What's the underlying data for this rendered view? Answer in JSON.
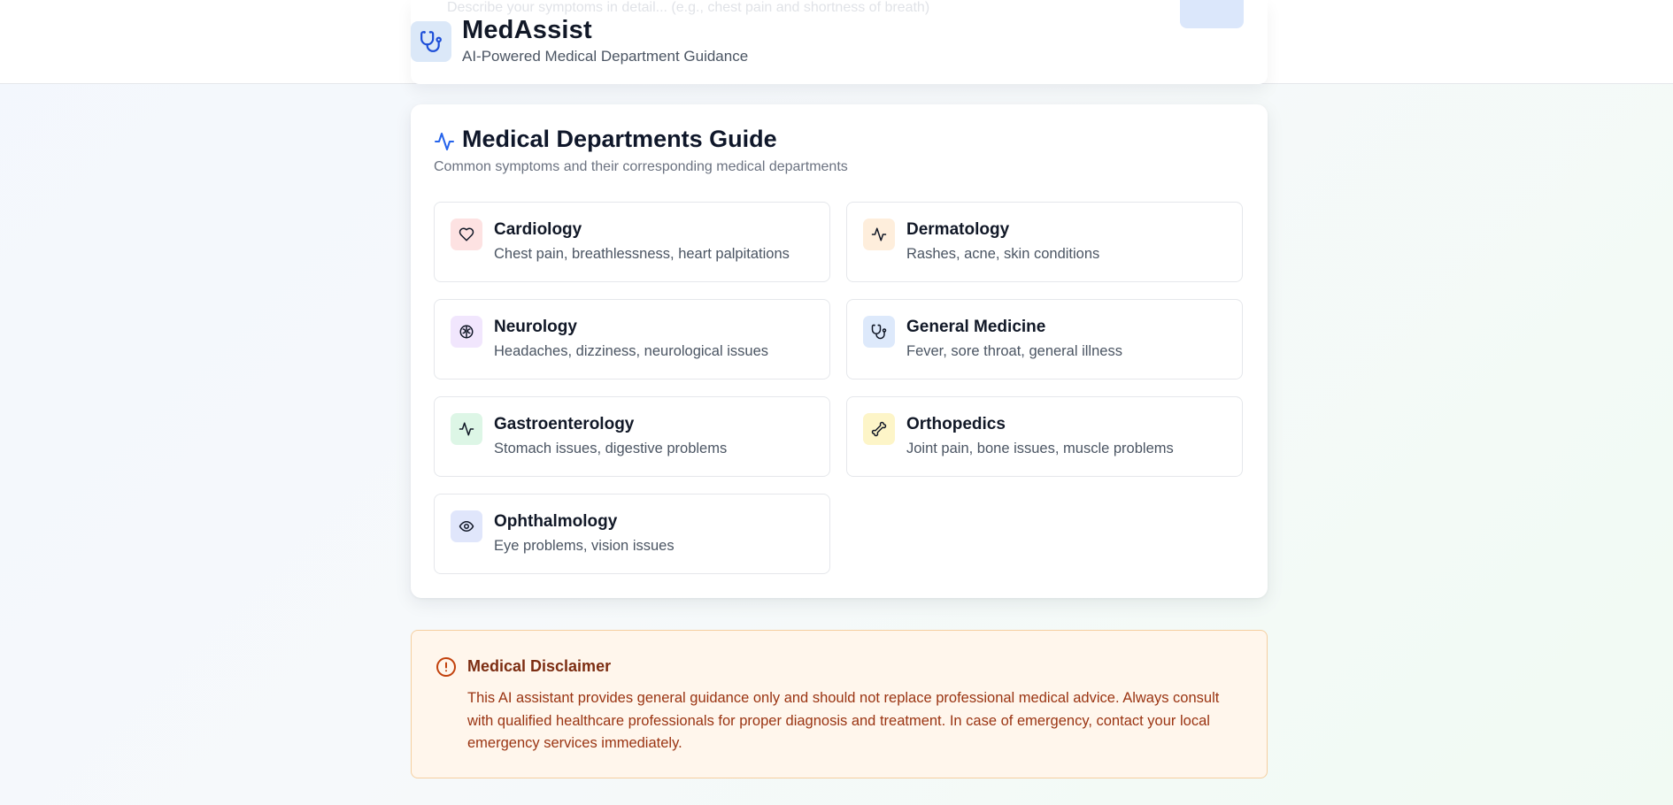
{
  "header": {
    "ghost_text": "Describe your symptoms in detail... (e.g., chest pain and shortness of breath)",
    "app_name": "MedAssist",
    "tagline": "AI-Powered Medical Department Guidance",
    "logo_icon": "stethoscope-icon"
  },
  "guide": {
    "title": "Medical Departments Guide",
    "subtitle": "Common symptoms and their corresponding medical departments",
    "title_icon": "activity-icon",
    "departments": [
      {
        "name": "Cardiology",
        "symptoms": "Chest pain, breathlessness, heart palpitations",
        "icon": "heart-icon",
        "tint": "#fde2e2"
      },
      {
        "name": "Dermatology",
        "symptoms": "Rashes, acne, skin conditions",
        "icon": "activity-icon",
        "tint": "#feeedc"
      },
      {
        "name": "Neurology",
        "symptoms": "Headaches, dizziness, neurological issues",
        "icon": "brain-icon",
        "tint": "#f1e6fd"
      },
      {
        "name": "General Medicine",
        "symptoms": "Fever, sore throat, general illness",
        "icon": "stethoscope-icon",
        "tint": "#dde9fb"
      },
      {
        "name": "Gastroenterology",
        "symptoms": "Stomach issues, digestive problems",
        "icon": "activity-icon",
        "tint": "#ddf6e6"
      },
      {
        "name": "Orthopedics",
        "symptoms": "Joint pain, bone issues, muscle problems",
        "icon": "bone-icon",
        "tint": "#fdf5c8"
      },
      {
        "name": "Ophthalmology",
        "symptoms": "Eye problems, vision issues",
        "icon": "eye-icon",
        "tint": "#e0e6fb"
      }
    ]
  },
  "disclaimer": {
    "title": "Medical Disclaimer",
    "icon": "alert-circle-icon",
    "text": "This AI assistant provides general guidance only and should not replace professional medical advice. Always consult with qualified healthcare professionals for proper diagnosis and treatment. In case of emergency, contact your local emergency services immediately."
  },
  "colors": {
    "accent": "#2563eb",
    "disclaimer_bg": "#fff6ec",
    "disclaimer_border": "#f5cfa0",
    "disclaimer_text": "#9a3412"
  }
}
